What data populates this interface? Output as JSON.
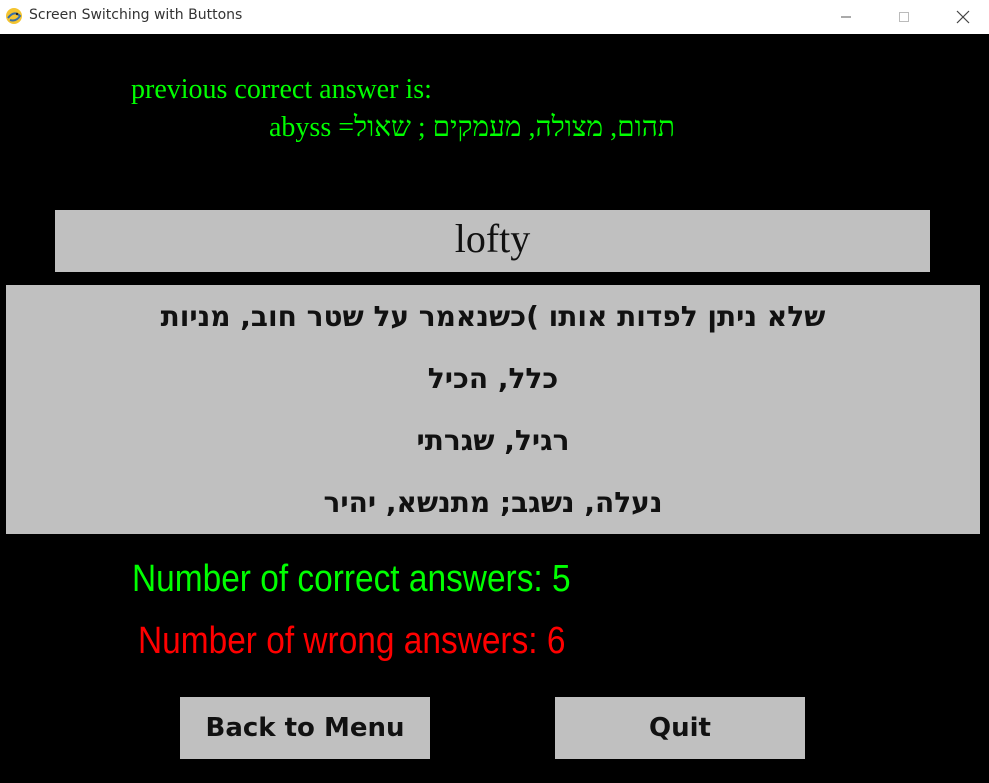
{
  "window": {
    "title": "Screen Switching with Buttons",
    "app_icon": "pygame-snake-icon",
    "controls": {
      "minimize_icon": "minimize-icon",
      "maximize_icon": "maximize-icon",
      "close_icon": "close-icon"
    }
  },
  "previous": {
    "label": "previous correct answer is:",
    "answer": "abyss =תהום, מצולה, מעמקים ; שאול"
  },
  "question": {
    "word": "lofty"
  },
  "options": [
    "שלא ניתן לפדות אותו )כשנאמר על שטר חוב, מניות",
    "כלל, הכיל",
    "רגיל, שגרתי",
    "נעלה, נשגב; מתנשא, יהיר"
  ],
  "stats": {
    "correct_label": "Number of correct answers: 5",
    "wrong_label": "Number of wrong answers: 6"
  },
  "buttons": {
    "back_label": "Back to Menu",
    "quit_label": "Quit"
  },
  "colors": {
    "background": "#000000",
    "correct": "#00ff00",
    "wrong": "#ff0000",
    "panel": "#c0c0c0"
  }
}
